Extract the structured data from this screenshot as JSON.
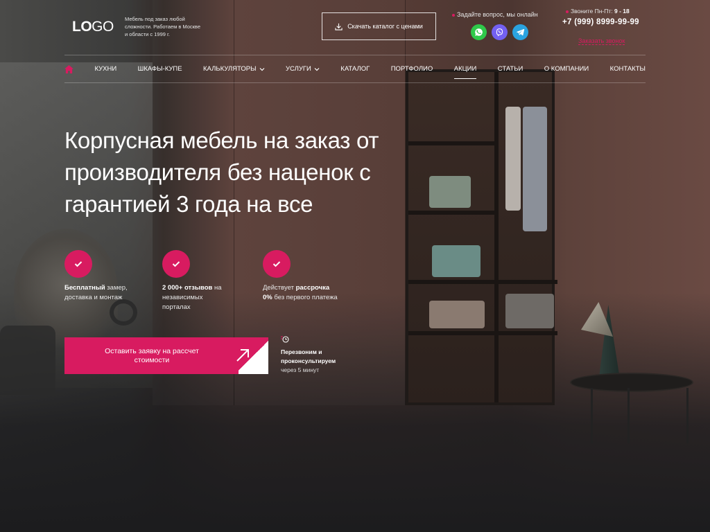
{
  "header": {
    "logo_bold": "LO",
    "logo_regular": "GO",
    "tagline": "Мебель под заказ любой сложности. Работаем в Москве и области с 1999 г.",
    "catalog_button": "Скачать каталог с ценами",
    "ask_question": "Задайте вопрос, мы онлайн",
    "messengers": [
      "whatsapp-icon",
      "viber-icon",
      "telegram-icon"
    ],
    "call_hours_prefix": "Звоните Пн-Пт:",
    "call_hours_value": "9 - 18",
    "phone": "+7 (999) 8999-99-99",
    "order_call": "Заказать звонок"
  },
  "nav": {
    "items": [
      {
        "label": "КУХНИ"
      },
      {
        "label": "ШКАФЫ-КУПЕ"
      },
      {
        "label": "КАЛЬКУЛЯТОРЫ"
      },
      {
        "label": "УСЛУГИ"
      },
      {
        "label": "КАТАЛОГ"
      },
      {
        "label": "ПОРТФОЛИО"
      },
      {
        "label": "АКЦИИ"
      },
      {
        "label": "СТАТЬИ"
      },
      {
        "label": "О КОМПАНИИ"
      },
      {
        "label": "КОНТАКТЫ"
      }
    ]
  },
  "hero": {
    "headline_line1": "Корпусная мебель на заказ от",
    "headline_line2": "производителя без наценок с",
    "headline_line3": "гарантией 3 года на все",
    "features": [
      {
        "bold": "Бесплатный",
        "text1": " замер,",
        "text2": "доставка и монтаж"
      },
      {
        "bold": "2 000+ отзывов",
        "text1": " на",
        "text2": "независимых",
        "text3": "порталах"
      },
      {
        "pre": "Действует ",
        "bold": "рассрочка",
        "bold2": "0%",
        "text2": " без первого платежа"
      }
    ],
    "cta_line1": "Оставить заявку на рассчет",
    "cta_line2": "стоимости",
    "callback_bold1": "Перезвоним и",
    "callback_bold2": "проконсультируем",
    "callback_text": "через 5 минут"
  },
  "colors": {
    "accent": "#d81b60",
    "background": "#1c1c1e"
  }
}
